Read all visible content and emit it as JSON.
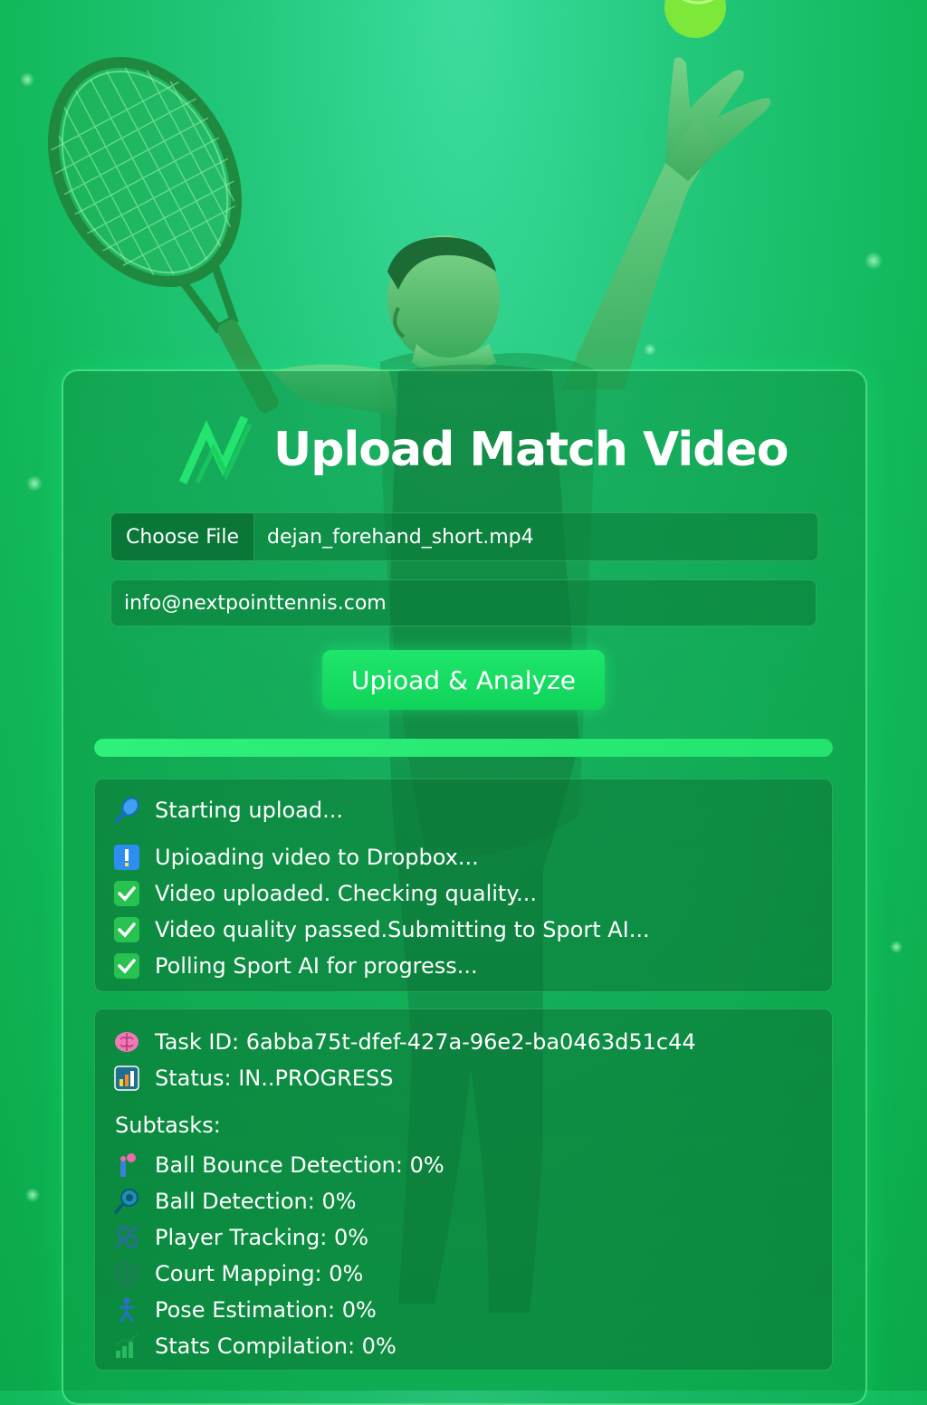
{
  "app": {
    "title": "Upload Match Video",
    "logo": "zigzag-n-logo-icon"
  },
  "upload": {
    "choose_file_label": "Choose File",
    "file_name": "dejan_forehand_short.mp4",
    "email_value": "info@nextpointtennis.com",
    "submit_label": "Upioad & Analyze",
    "progress": 1.0
  },
  "log": [
    {
      "icon": "tennis-racket-icon",
      "text": "Starting upload..."
    },
    {
      "icon": "exclamation-icon",
      "text": "Upioading video to Dropbox..."
    },
    {
      "icon": "check-mark-icon",
      "text": "Video uploaded. Checking quality..."
    },
    {
      "icon": "check-mark-icon",
      "text": "Video quality passed.Submitting to Sport AI..."
    },
    {
      "icon": "check-mark-icon",
      "text": "Polling Sport AI for progress..."
    }
  ],
  "status": {
    "task_id_text": "Task ID: 6abba75t-dfef-427a-96e2-ba0463d51c44",
    "status_text": "Status: IN..PROGRESS",
    "subtasks_label": "Subtasks:",
    "subtasks": [
      {
        "icon": "ball-bounce-icon",
        "text": "Ball Bounce Detection: 0%"
      },
      {
        "icon": "ball-detection-icon",
        "text": "Ball Detection: 0%"
      },
      {
        "icon": "player-tracking-icon",
        "text": "Player Tracking: 0%"
      },
      {
        "icon": "court-mapping-icon",
        "text": "Court Mapping: 0%"
      },
      {
        "icon": "pose-estimation-icon",
        "text": "Pose Estimation: 0%"
      },
      {
        "icon": "stats-chart-icon",
        "text": "Stats Compilation: 0%"
      }
    ]
  },
  "colors": {
    "accent": "#22e46e",
    "background": "#12b85a",
    "text": "#ffffff"
  }
}
